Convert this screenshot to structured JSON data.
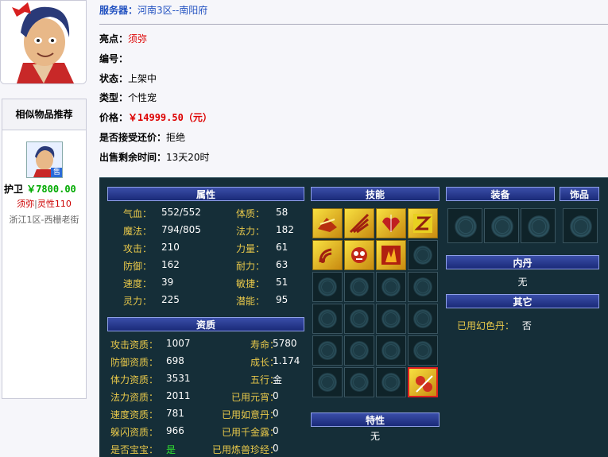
{
  "server": {
    "label": "服务器：",
    "value": "河南3区--南阳府"
  },
  "info": {
    "highlight_label": "亮点：",
    "highlight_value": "须弥",
    "id_label": "编号：",
    "id_value": "",
    "status_label": "状态：",
    "status_value": "上架中",
    "type_label": "类型：",
    "type_value": "个性宠",
    "price_label": "价格：",
    "price_value": "￥14999.50（元）",
    "bargain_label": "是否接受还价：",
    "bargain_value": "拒绝",
    "remaining_label": "出售剩余时间：",
    "remaining_value": "13天20时"
  },
  "similar": {
    "title": "相似物品推荐",
    "badge": "售",
    "name": "护卫",
    "price": "￥7800.00",
    "tag1": "须弥",
    "tag_sep": "|",
    "tag2": "灵性110",
    "server": "浙江1区-西栅老街"
  },
  "panel": {
    "attr_title": "属性",
    "attrs": [
      {
        "k1": "气血：",
        "v1": "552/552",
        "k2": "体质：",
        "v2": "58"
      },
      {
        "k1": "魔法：",
        "v1": "794/805",
        "k2": "法力：",
        "v2": "182"
      },
      {
        "k1": "攻击：",
        "v1": "210",
        "k2": "力量：",
        "v2": "61"
      },
      {
        "k1": "防御：",
        "v1": "162",
        "k2": "耐力：",
        "v2": "63"
      },
      {
        "k1": "速度：",
        "v1": "39",
        "k2": "敏捷：",
        "v2": "51"
      },
      {
        "k1": "灵力：",
        "v1": "225",
        "k2": "潜能：",
        "v2": "95"
      }
    ],
    "apt_title": "资质",
    "apts": [
      {
        "k1": "攻击资质：",
        "v1": "1007",
        "k2": "寿命：",
        "v2": "5780"
      },
      {
        "k1": "防御资质：",
        "v1": "698",
        "k2": "成长：",
        "v2": "1.174"
      },
      {
        "k1": "体力资质：",
        "v1": "3531",
        "k2": "五行：",
        "v2": "金"
      },
      {
        "k1": "法力资质：",
        "v1": "2011",
        "k2": "已用元宵：",
        "v2": "0"
      },
      {
        "k1": "速度资质：",
        "v1": "781",
        "k2": "已用如意丹：",
        "v2": "0"
      },
      {
        "k1": "躲闪资质：",
        "v1": "966",
        "k2": "已用千金露：",
        "v2": "0"
      },
      {
        "k1": "是否宝宝：",
        "v1": "是",
        "k2": "已用炼兽珍经：",
        "v2": "0"
      }
    ],
    "skills_title": "技能",
    "trait_title": "特性",
    "trait_value": "无",
    "equip_title": "装备",
    "acc_title": "饰品",
    "neidan_title": "内丹",
    "neidan_value": "无",
    "other_title": "其它",
    "other_label": "已用幻色丹：",
    "other_value": "否",
    "colors": {
      "bg": "#152e38",
      "key": "#e8c84a",
      "value": "#ffffff",
      "header": "#1a2a78"
    }
  }
}
